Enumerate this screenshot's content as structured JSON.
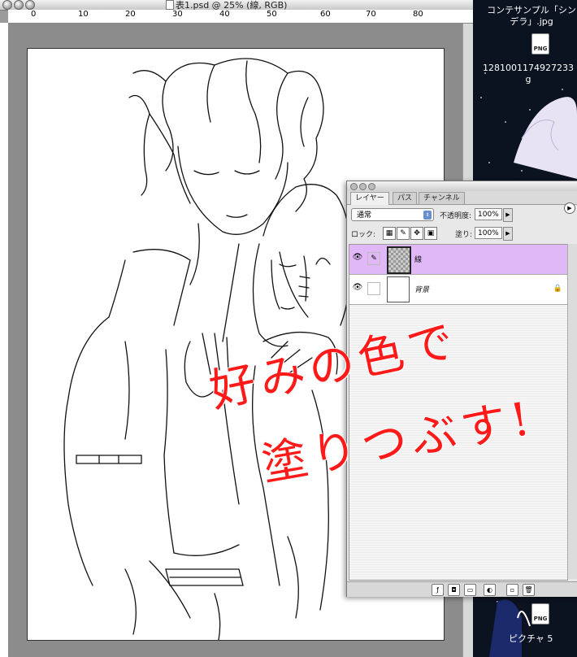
{
  "document": {
    "title": "表1.psd @ 25% (線, RGB)",
    "ruler_labels": [
      "0",
      "10",
      "20",
      "30",
      "40",
      "50",
      "60",
      "70",
      "80"
    ]
  },
  "desktop": {
    "file1_name": "コンテサンプル「シンデラ」.jpg",
    "file2_name": "1281001174927233g",
    "file3_name": "ピクチャ 5",
    "icon_label": "PNG"
  },
  "layers_panel": {
    "tabs": [
      "レイヤー",
      "パス",
      "チャンネル"
    ],
    "blend_mode": "通常",
    "opacity_label": "不透明度:",
    "opacity_value": "100%",
    "lock_label": "ロック:",
    "fill_label": "塗り:",
    "fill_value": "100%",
    "layers": [
      {
        "name": "線",
        "selected": true
      },
      {
        "name": "背景",
        "selected": false,
        "locked": true
      }
    ]
  },
  "overlay_text": {
    "line1": "好みの色で",
    "line2": "塗りつぶす!",
    "color": "#ff1a1a"
  },
  "colors": {
    "selected_layer": "#e0b8f8",
    "desktop_bg": "#0b1220"
  }
}
